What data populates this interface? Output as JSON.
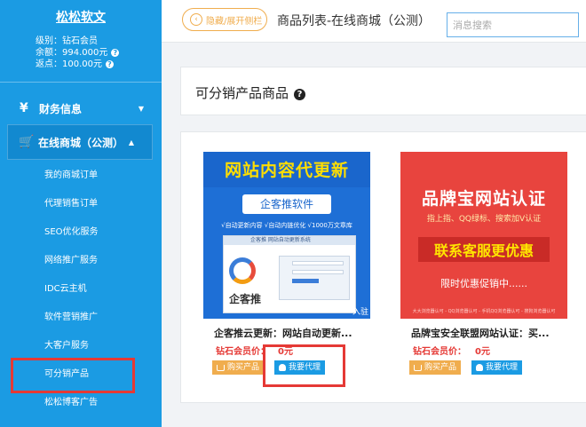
{
  "sidebar": {
    "brand": "松松软文",
    "account": {
      "level": "级别：钻石会员",
      "balance": "余额：994.000元",
      "rebate": "返点：100.00元"
    },
    "menus": {
      "finance": "财务信息",
      "online": "在线商城（公测）"
    },
    "submenu": [
      "我的商城订单",
      "代理销售订单",
      "SEO优化服务",
      "网络推广服务",
      "IDC云主机",
      "软件营销推广",
      "大客户服务",
      "可分销产品",
      "松松博客广告"
    ]
  },
  "topbar": {
    "toggle_label": "隐藏/展开侧栏",
    "page_title": "商品列表-在线商城（公测）",
    "search_placeholder": "消息搜索"
  },
  "section": {
    "title": "可分销产品商品"
  },
  "products": [
    {
      "name": "企客推云更新：网站自动更新...",
      "price_label": "钻石会员价：",
      "price": "0元",
      "buy_label": "购买产品",
      "agent_label": "我要代理",
      "image": {
        "banner": "网站内容代更新",
        "tag": "企客推软件",
        "tagline": "√自动更新内容  √自动内链优化  √1000万文章库",
        "app_title": "企客推   网站自动更新系统",
        "brand": "企客推",
        "corner": "入驻"
      }
    },
    {
      "name": "品牌宝安全联盟网站认证：买...",
      "price_label": "钻石会员价：",
      "price": "0元",
      "buy_label": "购买产品",
      "agent_label": "我要代理",
      "image": {
        "title": "品牌宝网站认证",
        "subtitle": "指上指、QQ绿标、搜索加V认证",
        "cta": "联系客服更优惠",
        "promo": "限时优惠促销中......",
        "footer": "大大浏览器认可 - QQ浏览器认可 - 手机QQ浏览器认可 - 搜狗浏览器认可"
      }
    }
  ],
  "colors": {
    "sidebar": "#1b9be3",
    "active_menu": "#1289d0",
    "accent_orange": "#f0ad4e",
    "price_red": "#e53935",
    "highlight": "#e53935"
  }
}
